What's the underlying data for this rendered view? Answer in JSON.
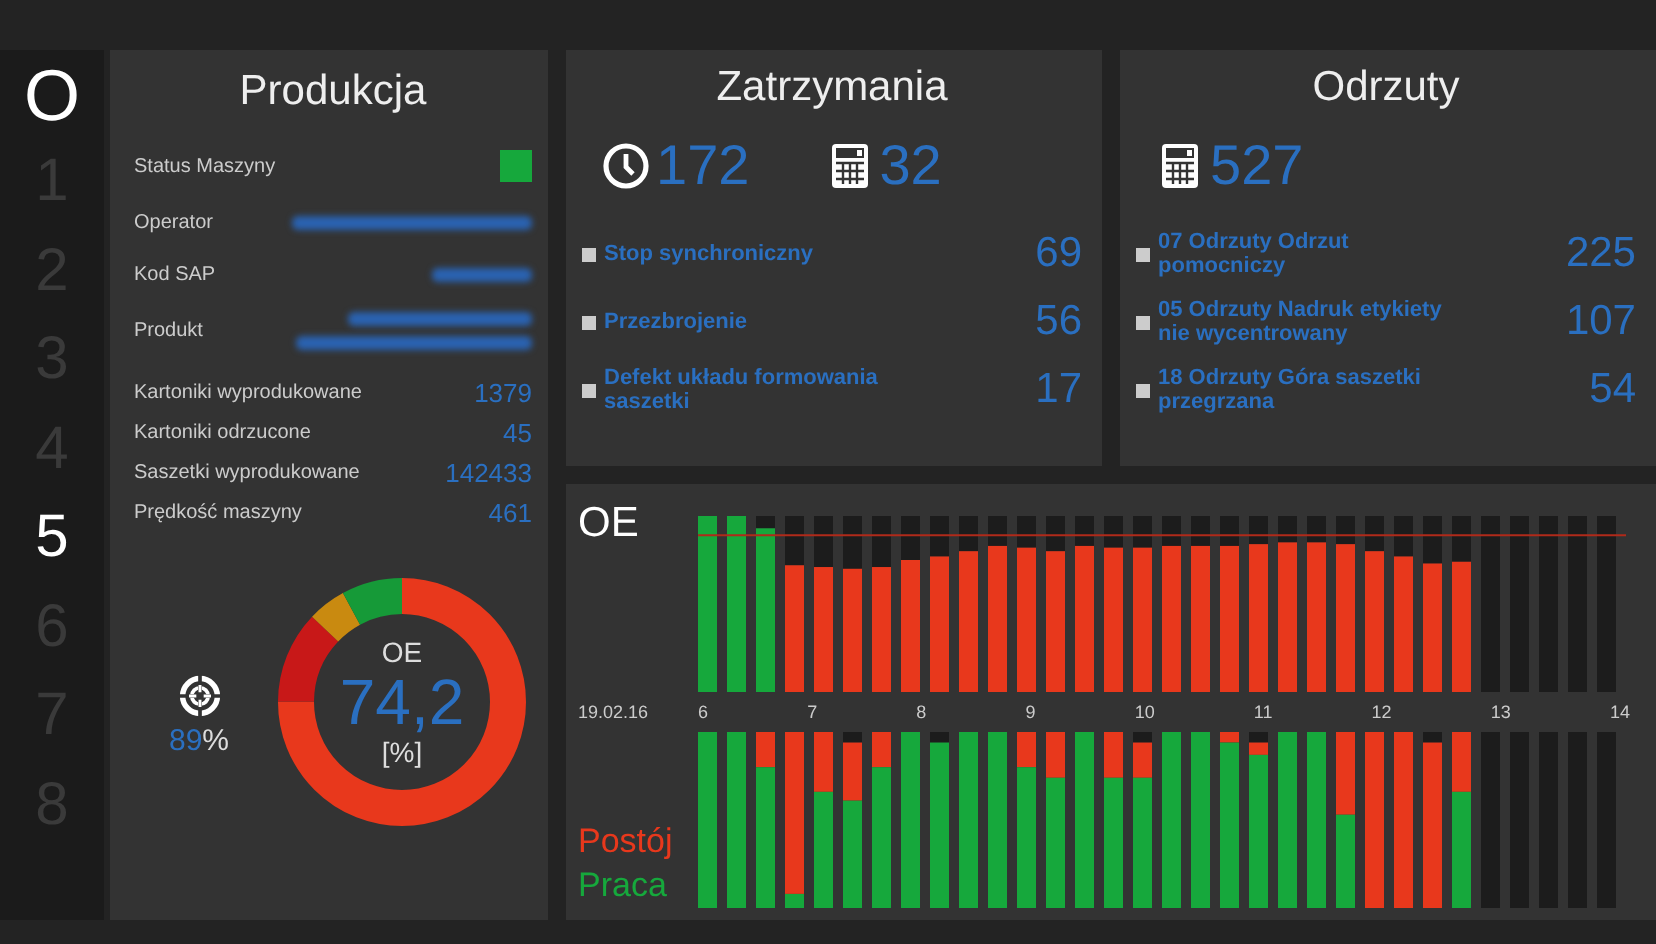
{
  "sidebar": {
    "logo": "O",
    "items": [
      {
        "label": "1",
        "selected": false
      },
      {
        "label": "2",
        "selected": false
      },
      {
        "label": "3",
        "selected": false
      },
      {
        "label": "4",
        "selected": false
      },
      {
        "label": "5",
        "selected": true
      },
      {
        "label": "6",
        "selected": false
      },
      {
        "label": "7",
        "selected": false
      },
      {
        "label": "8",
        "selected": false
      }
    ]
  },
  "production": {
    "title": "Produkcja",
    "status": {
      "label": "Status Maszyny",
      "running": true
    },
    "fields": [
      {
        "label": "Operator",
        "kind": "redacted_line"
      },
      {
        "label": "Kod SAP",
        "kind": "redacted_short"
      },
      {
        "label": "Produkt",
        "kind": "redacted_two_lines"
      }
    ],
    "counters": [
      {
        "label": "Kartoniki wyprodukowane",
        "value": "1379"
      },
      {
        "label": "Kartoniki odrzucone",
        "value": "45"
      },
      {
        "label": "Saszetki wyprodukowane",
        "value": "142433"
      },
      {
        "label": "Prędkość maszyny",
        "value": "461"
      }
    ],
    "target": {
      "value": "89",
      "unit": "%"
    },
    "gauge": {
      "label": "OE",
      "value": "74,2",
      "unit": "[%]"
    }
  },
  "stops": {
    "title": "Zatrzymania",
    "totals": [
      {
        "kind": "time",
        "value": "172"
      },
      {
        "kind": "count",
        "value": "32"
      }
    ],
    "items": [
      {
        "label": "Stop synchroniczny",
        "value": "69"
      },
      {
        "label": "Przezbrojenie",
        "value": "56"
      },
      {
        "label": "Defekt układu formowania saszetki",
        "value": "17"
      }
    ]
  },
  "rejects": {
    "title": "Odrzuty",
    "totals": [
      {
        "kind": "count",
        "value": "527"
      }
    ],
    "items": [
      {
        "label": "07 Odrzuty Odrzut pomocniczy",
        "value": "225"
      },
      {
        "label": "05 Odrzuty Nadruk etykiety nie wycentrowany",
        "value": "107"
      },
      {
        "label": "18 Odrzuty Góra saszetki przegrzana",
        "value": "54"
      }
    ]
  },
  "chart": {
    "title": "OE",
    "date": "19.02.16",
    "hours": [
      "6",
      "7",
      "8",
      "9",
      "10",
      "11",
      "12",
      "13",
      "14"
    ],
    "legend": [
      {
        "label": "Postój",
        "color": "#e8381c"
      },
      {
        "label": "Praca",
        "color": "#16a83c"
      }
    ]
  }
}
